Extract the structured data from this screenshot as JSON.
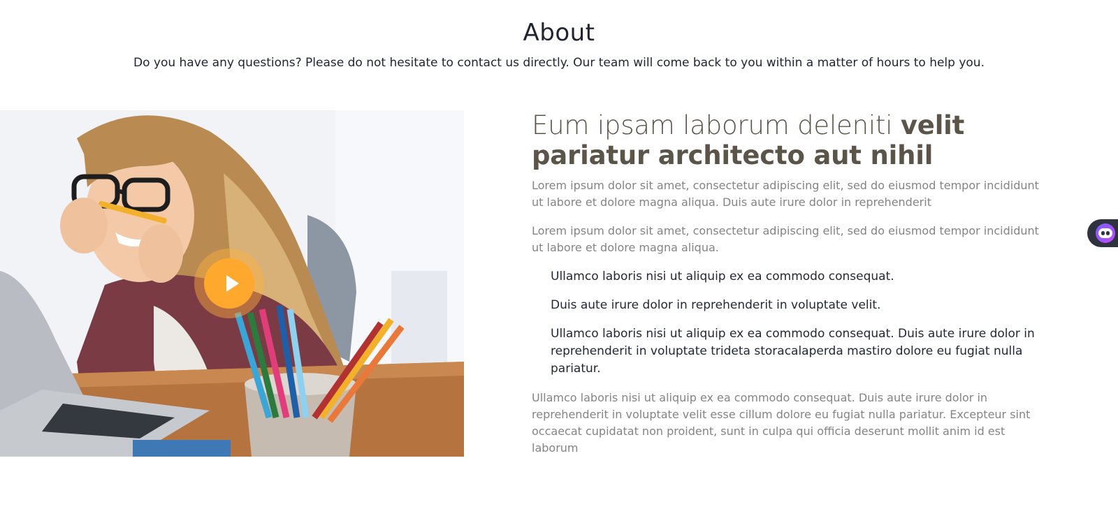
{
  "section": {
    "title": "About",
    "subtitle": "Do you have any questions? Please do not hesitate to contact us directly. Our team will come back to you within a matter of hours to help you."
  },
  "media": {
    "image_alt": "woman-with-pencils-photo",
    "play_icon": "play-icon"
  },
  "content": {
    "heading_light": "Eum ipsam laborum deleniti ",
    "heading_bold": "velit pariatur architecto aut nihil",
    "paragraph_1": "Lorem ipsum dolor sit amet, consectetur adipiscing elit, sed do eiusmod tempor incididunt ut labore et dolore magna aliqua. Duis aute irure dolor in reprehenderit",
    "paragraph_2": "Lorem ipsum dolor sit amet, consectetur adipiscing elit, sed do eiusmod tempor incididunt ut labore et dolore magna aliqua.",
    "list": [
      "Ullamco laboris nisi ut aliquip ex ea commodo consequat.",
      "Duis aute irure dolor in reprehenderit in voluptate velit.",
      "Ullamco laboris nisi ut aliquip ex ea commodo consequat. Duis aute irure dolor in reprehenderit in voluptate trideta storacalaperda mastiro dolore eu fugiat nulla pariatur."
    ],
    "paragraph_3": "Ullamco laboris nisi ut aliquip ex ea commodo consequat. Duis aute irure dolor in reprehenderit in voluptate velit esse cillum dolore eu fugiat nulla pariatur. Excepteur sint occaecat cupidatat non proident, sunt in culpa qui officia deserunt mollit anim id est laborum"
  },
  "widget": {
    "icon": "assistant-icon"
  },
  "colors": {
    "accent": "#ffa82e",
    "heading": "#5a5449",
    "body_text": "#848484",
    "dark_text": "#222834",
    "widget_bg": "#2f3340"
  }
}
